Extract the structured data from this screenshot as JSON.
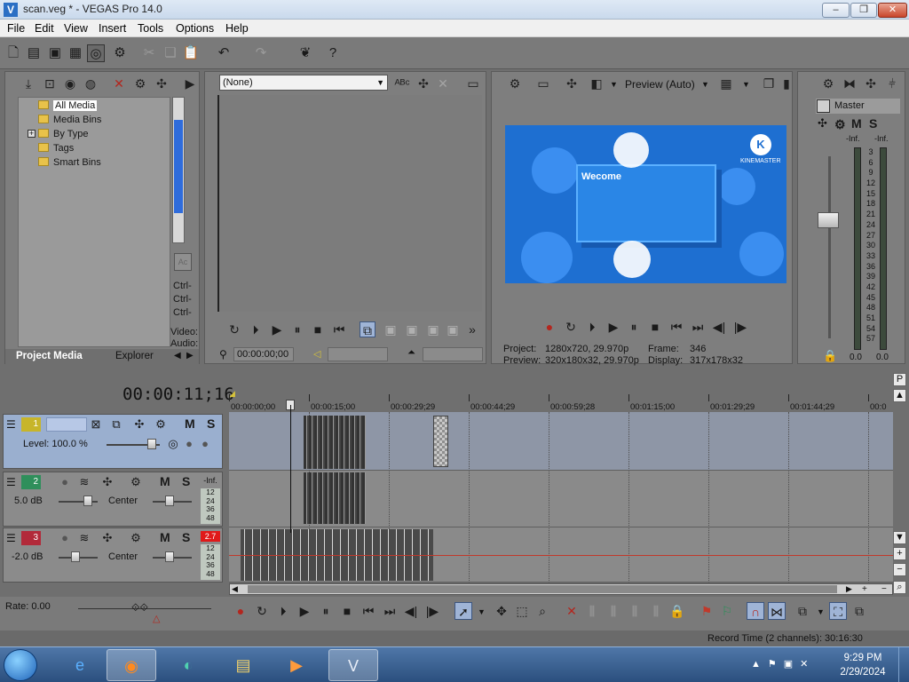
{
  "window": {
    "title": "scan.veg * - VEGAS Pro 14.0",
    "app_icon": "vegas-icon",
    "buttons": [
      "minimize",
      "maximize",
      "close"
    ]
  },
  "menubar": [
    "File",
    "Edit",
    "View",
    "Insert",
    "Tools",
    "Options",
    "Help"
  ],
  "project_media": {
    "tree": [
      {
        "label": "All Media"
      },
      {
        "label": "Media Bins"
      },
      {
        "label": "By Type"
      },
      {
        "label": "Tags"
      },
      {
        "label": "Smart Bins"
      }
    ],
    "side_labels": [
      "Ctrl-",
      "Ctrl-",
      "Ctrl-",
      "Video:",
      "Audio:"
    ],
    "tabs": [
      "Project Media",
      "Explorer"
    ]
  },
  "trimmer": {
    "dropdown_value": "(None)",
    "timecode": "00:00:00;00"
  },
  "video_preview": {
    "mode_label": "Preview (Auto)",
    "frame_text": "Wecome",
    "brand_text": "KINEMASTER",
    "logo_letter": "K",
    "info": {
      "project_label": "Project:",
      "project_value": "1280x720, 29.970p",
      "preview_label": "Preview:",
      "preview_value": "320x180x32, 29.970p",
      "frame_label": "Frame:",
      "frame_value": "346",
      "display_label": "Display:",
      "display_value": "317x178x32"
    }
  },
  "master_bus": {
    "label": "Master",
    "ms": [
      "M",
      "S"
    ],
    "inf_left": "-Inf.",
    "inf_right": "-Inf.",
    "scale": [
      "3",
      "6",
      "9",
      "12",
      "15",
      "18",
      "21",
      "24",
      "27",
      "30",
      "33",
      "36",
      "39",
      "42",
      "45",
      "48",
      "51",
      "54",
      "57"
    ],
    "value_left": "0.0",
    "value_right": "0.0"
  },
  "timeline": {
    "current_time": "00:00:11;16",
    "ruler_labels": [
      "00:00:00;00",
      "00:00:15;00",
      "00:00:29;29",
      "00:00:44;29",
      "00:00:59;28",
      "00:01:15;00",
      "00:01:29;29",
      "00:01:44;29",
      "00:0"
    ]
  },
  "tracks": [
    {
      "number": "1",
      "kind": "video",
      "level_label": "Level: 100.0 %",
      "m": "M",
      "s": "S",
      "color": "#c7b52a"
    },
    {
      "number": "2",
      "kind": "audio",
      "volume": "5.0 dB",
      "pan": "Center",
      "m": "M",
      "s": "S",
      "peak": "-Inf.",
      "meter": [
        "12",
        "24",
        "36",
        "48"
      ],
      "color": "#2f8f5b"
    },
    {
      "number": "3",
      "kind": "audio",
      "volume": "-2.0 dB",
      "pan": "Center",
      "m": "M",
      "s": "S",
      "peak": "2.7",
      "meter": [
        "12",
        "24",
        "36",
        "48"
      ],
      "color": "#b22a3a"
    }
  ],
  "transport": {
    "rate": "Rate: 0.00"
  },
  "status": {
    "record_time": "Record Time (2 channels): 30:16:30"
  },
  "taskbar": {
    "apps": [
      "internet-explorer-icon",
      "firefox-icon",
      "edge-icon",
      "file-explorer-icon",
      "media-player-icon",
      "vegas-icon"
    ],
    "time": "9:29 PM",
    "date": "2/29/2024"
  }
}
